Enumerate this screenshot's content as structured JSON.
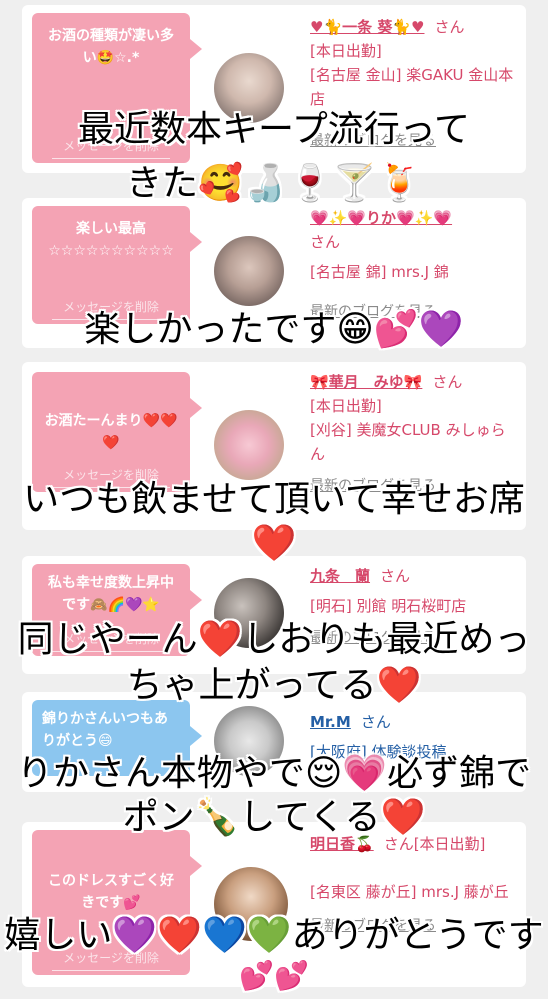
{
  "cards": [
    {
      "message": "お酒の種類が凄い多い🤩☆.*",
      "delete_label": "メッセージを削除",
      "name": "♥🐈一条 葵🐈♥",
      "honorific": "さん",
      "details": [
        "[本日出勤]",
        "[名古屋 金山] 楽GAKU 金山本店"
      ],
      "blog_link": "最新のブログを見る"
    },
    {
      "message": "楽しい最高 ☆☆☆☆☆☆☆☆☆☆",
      "delete_label": "メッセージを削除",
      "name": "💗✨💗りか💗✨💗",
      "honorific": "さん",
      "details": [
        "[名古屋 錦] mrs.J 錦"
      ],
      "blog_link": "最新のブログを見る"
    },
    {
      "message": "お酒たーんまり❤️❤️❤️",
      "delete_label": "メッセージを削除",
      "name": "🎀華月　みゆ🎀",
      "honorific": "さん",
      "details": [
        "[本日出勤]",
        "[刈谷] 美魔女CLUB みしゅらん"
      ],
      "blog_link": "最新のブログを見る"
    },
    {
      "message": "私も幸せ度数上昇中です🙈🌈💜⭐",
      "delete_label": "メッセージを削除",
      "name": "九条　蘭",
      "honorific": "さん",
      "details": [
        "[明石] 別館 明石桜町店"
      ],
      "blog_link": "最新のブログを見る"
    },
    {
      "message": "錦りかさんいつもありがとう😄",
      "delete_label": "",
      "name": "Mr.M",
      "honorific": "さん",
      "details": [
        "[大阪府] 体験談投稿"
      ],
      "blog_link": ""
    },
    {
      "message": "このドレスすごく好きです💕",
      "delete_label": "メッセージを削除",
      "name": "明日香🍒",
      "honorific": "さん[本日出勤]",
      "details": [
        "[名東区 藤が丘] mrs.J 藤が丘"
      ],
      "blog_link": "最新のブログを見る"
    }
  ],
  "overlay": {
    "line1": "最近数本キープ流行って",
    "line2": "きた🥰🍶🍷🍸🍹",
    "line3": "楽しかったです😁💕💜",
    "line4": "いつも飲ませて頂いて幸せお席",
    "line5": "❤️",
    "line6": "同じやーん❤️しおりも最近めっ",
    "line7": "ちゃ上がってる❤️",
    "line8": "りかさん本物やで😌💗必ず錦で",
    "line9": "ポン🍾してくる❤️",
    "line10": "嬉しい💜❤️💙💚ありがとうです",
    "line11": "💕💕"
  },
  "colors": {
    "pink_bubble": "#f4a3b4",
    "blue_bubble": "#8cc6ef",
    "name_pink": "#d6486a",
    "name_blue": "#245fa5"
  }
}
